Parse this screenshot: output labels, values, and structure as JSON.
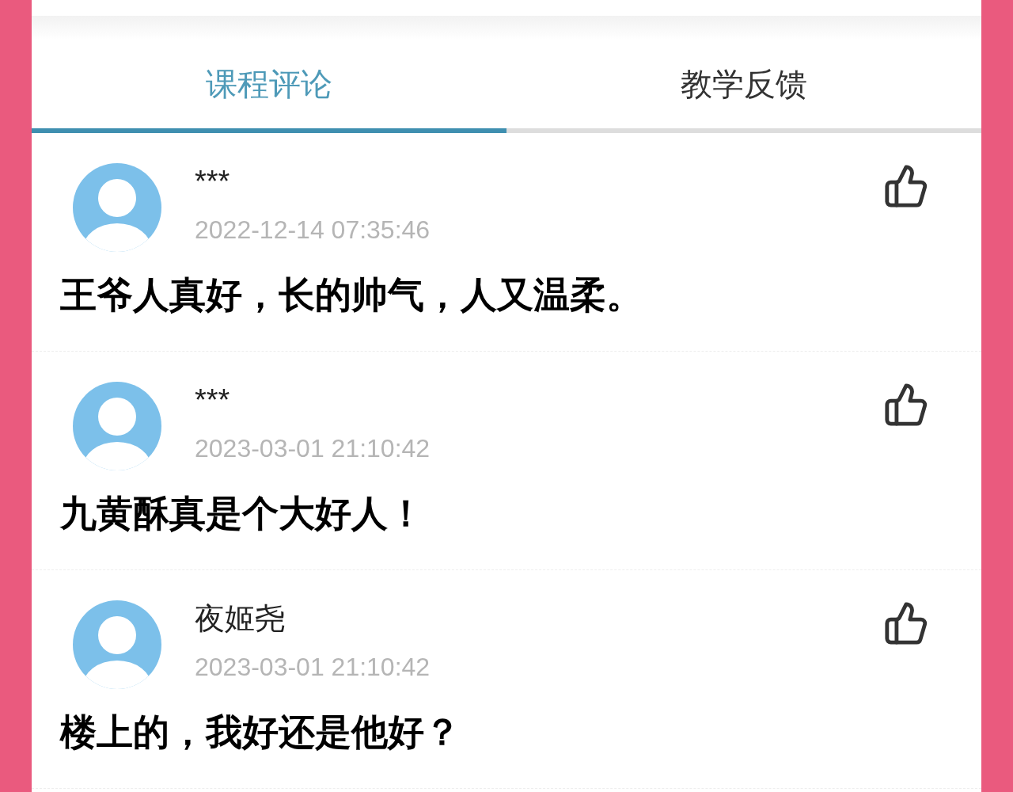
{
  "tabs": [
    {
      "label": "课程评论",
      "selected": true
    },
    {
      "label": "教学反馈",
      "selected": false
    }
  ],
  "comments": [
    {
      "name": "***",
      "time": "2022-12-14 07:35:46",
      "text": "王爷人真好，长的帅气，人又温柔。"
    },
    {
      "name": "***",
      "time": "2023-03-01 21:10:42",
      "text": "九黄酥真是个大好人！"
    },
    {
      "name": "夜姬尧",
      "time": "2023-03-01 21:10:42",
      "text": "楼上的，我好还是他好？"
    }
  ]
}
